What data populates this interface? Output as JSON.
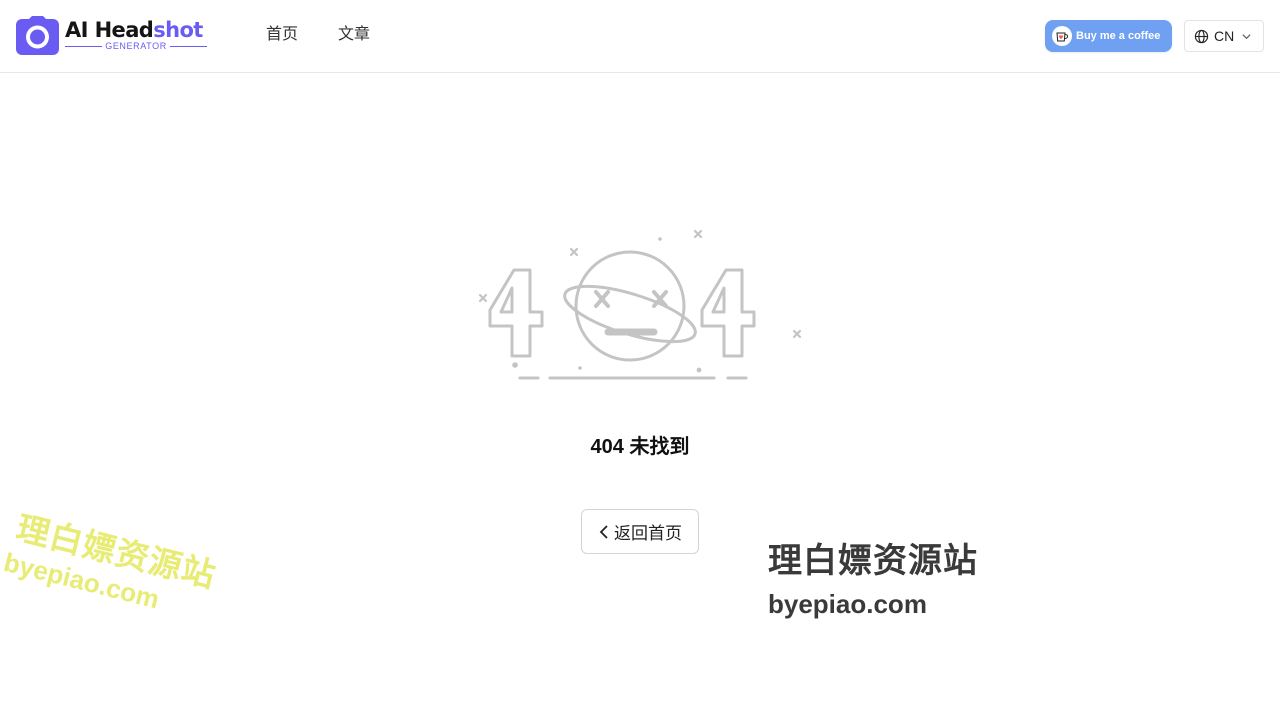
{
  "header": {
    "logo": {
      "title_main": "AI Head",
      "title_accent": "shot",
      "subtitle": "GENERATOR"
    },
    "nav": [
      {
        "label": "首页"
      },
      {
        "label": "文章"
      }
    ],
    "coffee_button": {
      "label": "Buy me a coffee"
    },
    "language": {
      "value": "CN"
    }
  },
  "main": {
    "error_title": "404 未找到",
    "back_button": {
      "label": "返回首页"
    }
  },
  "watermarks": [
    {
      "cn": "理白嫖资源站",
      "en": "byepiao.com"
    },
    {
      "cn": "理白嫖资源站",
      "en": "byepiao.com"
    }
  ],
  "colors": {
    "accent": "#6a5cf2",
    "coffee_bg": "#6fa0f2",
    "illustration_gray": "#c4c4c4",
    "watermark_yellow": "#e8ec74"
  }
}
